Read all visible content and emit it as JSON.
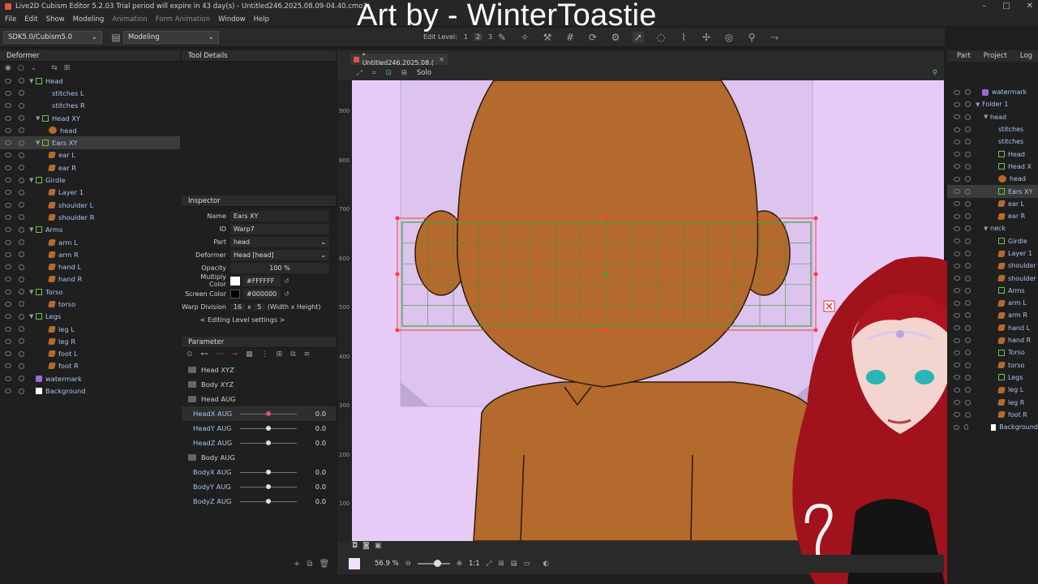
{
  "window": {
    "title": "Live2D Cubism Editor 5.2.03   Trial period will expire in 43 day(s)  - Untitled246.2025.08.09-04.40.cmo3",
    "controls": [
      "–",
      "□",
      "✕"
    ]
  },
  "overlay_text": "Art by - WinterToastie",
  "menu": [
    "File",
    "Edit",
    "Show",
    "Modeling",
    "Animation",
    "Form Animation",
    "Window",
    "Help"
  ],
  "toolbar": {
    "sdk_select": "SDK5.0/Cubism5.0",
    "mode_select": "Modeling",
    "edit_level_label": "Edit Level:",
    "edit_levels": [
      "1",
      "2",
      "3"
    ]
  },
  "deformer": {
    "title": "Deformer",
    "items": [
      {
        "label": "Head",
        "type": "warp",
        "arrow": "▼"
      },
      {
        "label": "stitches L",
        "type": "none"
      },
      {
        "label": "stitches R",
        "type": "none"
      },
      {
        "label": "Head XY",
        "type": "warp",
        "arrow": "▼"
      },
      {
        "label": "head",
        "type": "round"
      },
      {
        "label": "Ears XY",
        "type": "warp",
        "arrow": "▼"
      },
      {
        "label": "ear L",
        "type": "art"
      },
      {
        "label": "ear R",
        "type": "art"
      },
      {
        "label": "Girdle",
        "type": "warp",
        "arrow": "▼"
      },
      {
        "label": "Layer 1",
        "type": "art"
      },
      {
        "label": "shoulder L",
        "type": "art"
      },
      {
        "label": "shoulder R",
        "type": "art"
      },
      {
        "label": "Arms",
        "type": "warp",
        "arrow": "▼"
      },
      {
        "label": "arm L",
        "type": "art"
      },
      {
        "label": "arm R",
        "type": "art"
      },
      {
        "label": "hand L",
        "type": "art"
      },
      {
        "label": "hand R",
        "type": "art"
      },
      {
        "label": "Torso",
        "type": "warp",
        "arrow": "▼"
      },
      {
        "label": "torso",
        "type": "art"
      },
      {
        "label": "Legs",
        "type": "warp",
        "arrow": "▼"
      },
      {
        "label": "leg L",
        "type": "art"
      },
      {
        "label": "leg R",
        "type": "art"
      },
      {
        "label": "foot L",
        "type": "art"
      },
      {
        "label": "foot R",
        "type": "art"
      },
      {
        "label": "watermark",
        "type": "wm"
      },
      {
        "label": "Background",
        "type": "bg"
      }
    ]
  },
  "tool_details": {
    "title": "Tool Details"
  },
  "inspector": {
    "title": "Inspector",
    "name_label": "Name",
    "name_value": "Ears XY",
    "id_label": "ID",
    "id_value": "Warp7",
    "part_label": "Part",
    "part_value": "head",
    "deformer_label": "Deformer",
    "deformer_value": "Head  [head]",
    "opacity_label": "Opacity",
    "opacity_value": "100 %",
    "multiply_label": "Multiply Color",
    "multiply_value": "#FFFFFF",
    "screen_label": "Screen Color",
    "screen_value": "#000000",
    "warp_label": "Warp Division",
    "warp_w": "16",
    "warp_x": "x",
    "warp_h": "5",
    "warp_note": "(Width x Height)",
    "editing_level": "< Editing Level settings >"
  },
  "parameter": {
    "title": "Parameter",
    "rows": [
      {
        "kind": "group",
        "label": "Head XYZ"
      },
      {
        "kind": "group",
        "label": "Body XYZ"
      },
      {
        "kind": "group",
        "label": "Head AUG"
      },
      {
        "kind": "param",
        "label": "HeadX AUG",
        "value": "0.0",
        "pos": 0.5
      },
      {
        "kind": "param",
        "label": "HeadY AUG",
        "value": "0.0",
        "pos": 0.5
      },
      {
        "kind": "param",
        "label": "HeadZ AUG",
        "value": "0.0",
        "pos": 0.5
      },
      {
        "kind": "group",
        "label": "Body AUG"
      },
      {
        "kind": "param",
        "label": "BodyX AUG",
        "value": "0.0",
        "pos": 0.5
      },
      {
        "kind": "param",
        "label": "BodyY AUG",
        "value": "0.0",
        "pos": 0.5
      },
      {
        "kind": "param",
        "label": "BodyZ AUG",
        "value": "0.0",
        "pos": 0.5
      }
    ]
  },
  "canvas": {
    "tab_label": "* Untitled246.2025.08.(",
    "solo_label": "Solo",
    "ruler_ticks": [
      "900",
      "800",
      "700",
      "600",
      "500",
      "400",
      "300",
      "200",
      "100"
    ],
    "zoom": "56.9 %",
    "ratio": "1:1"
  },
  "right_panel": {
    "tabs": [
      "Part",
      "Project",
      "Log"
    ],
    "items": [
      {
        "label": "watermark",
        "type": "wm",
        "indent": 0
      },
      {
        "label": "Folder 1",
        "type": "none",
        "indent": 0,
        "arrow": "▼"
      },
      {
        "label": "head",
        "type": "none",
        "indent": 1,
        "arrow": "▼"
      },
      {
        "label": "stitches",
        "type": "none",
        "indent": 2
      },
      {
        "label": "stitches",
        "type": "none",
        "indent": 2
      },
      {
        "label": "Head",
        "type": "warp",
        "indent": 2
      },
      {
        "label": "Head X",
        "type": "warp",
        "indent": 2
      },
      {
        "label": "head",
        "type": "round",
        "indent": 2
      },
      {
        "label": "Ears XY",
        "type": "warp",
        "indent": 2
      },
      {
        "label": "ear L",
        "type": "art",
        "indent": 2
      },
      {
        "label": "ear R",
        "type": "art",
        "indent": 2
      },
      {
        "label": "neck",
        "type": "none",
        "indent": 1,
        "arrow": "▼"
      },
      {
        "label": "Girdle",
        "type": "warp",
        "indent": 2
      },
      {
        "label": "Layer 1",
        "type": "art",
        "indent": 2
      },
      {
        "label": "shoulder",
        "type": "art",
        "indent": 2
      },
      {
        "label": "shoulder",
        "type": "art",
        "indent": 2
      },
      {
        "label": "Arms",
        "type": "warp",
        "indent": 2
      },
      {
        "label": "arm L",
        "type": "art",
        "indent": 2
      },
      {
        "label": "arm R",
        "type": "art",
        "indent": 2
      },
      {
        "label": "hand L",
        "type": "art",
        "indent": 2
      },
      {
        "label": "hand R",
        "type": "art",
        "indent": 2
      },
      {
        "label": "Torso",
        "type": "warp",
        "indent": 2
      },
      {
        "label": "torso",
        "type": "art",
        "indent": 2
      },
      {
        "label": "Legs",
        "type": "warp",
        "indent": 2
      },
      {
        "label": "leg L",
        "type": "art",
        "indent": 2
      },
      {
        "label": "leg R",
        "type": "art",
        "indent": 2
      },
      {
        "label": "foot R",
        "type": "art",
        "indent": 2
      },
      {
        "label": "Background",
        "type": "bg",
        "indent": 2
      }
    ]
  },
  "colors": {
    "accent": "#6ec24a",
    "art": "#b46a2c",
    "stage": "#e6cbf6",
    "selection_red": "#ff3b3b"
  }
}
